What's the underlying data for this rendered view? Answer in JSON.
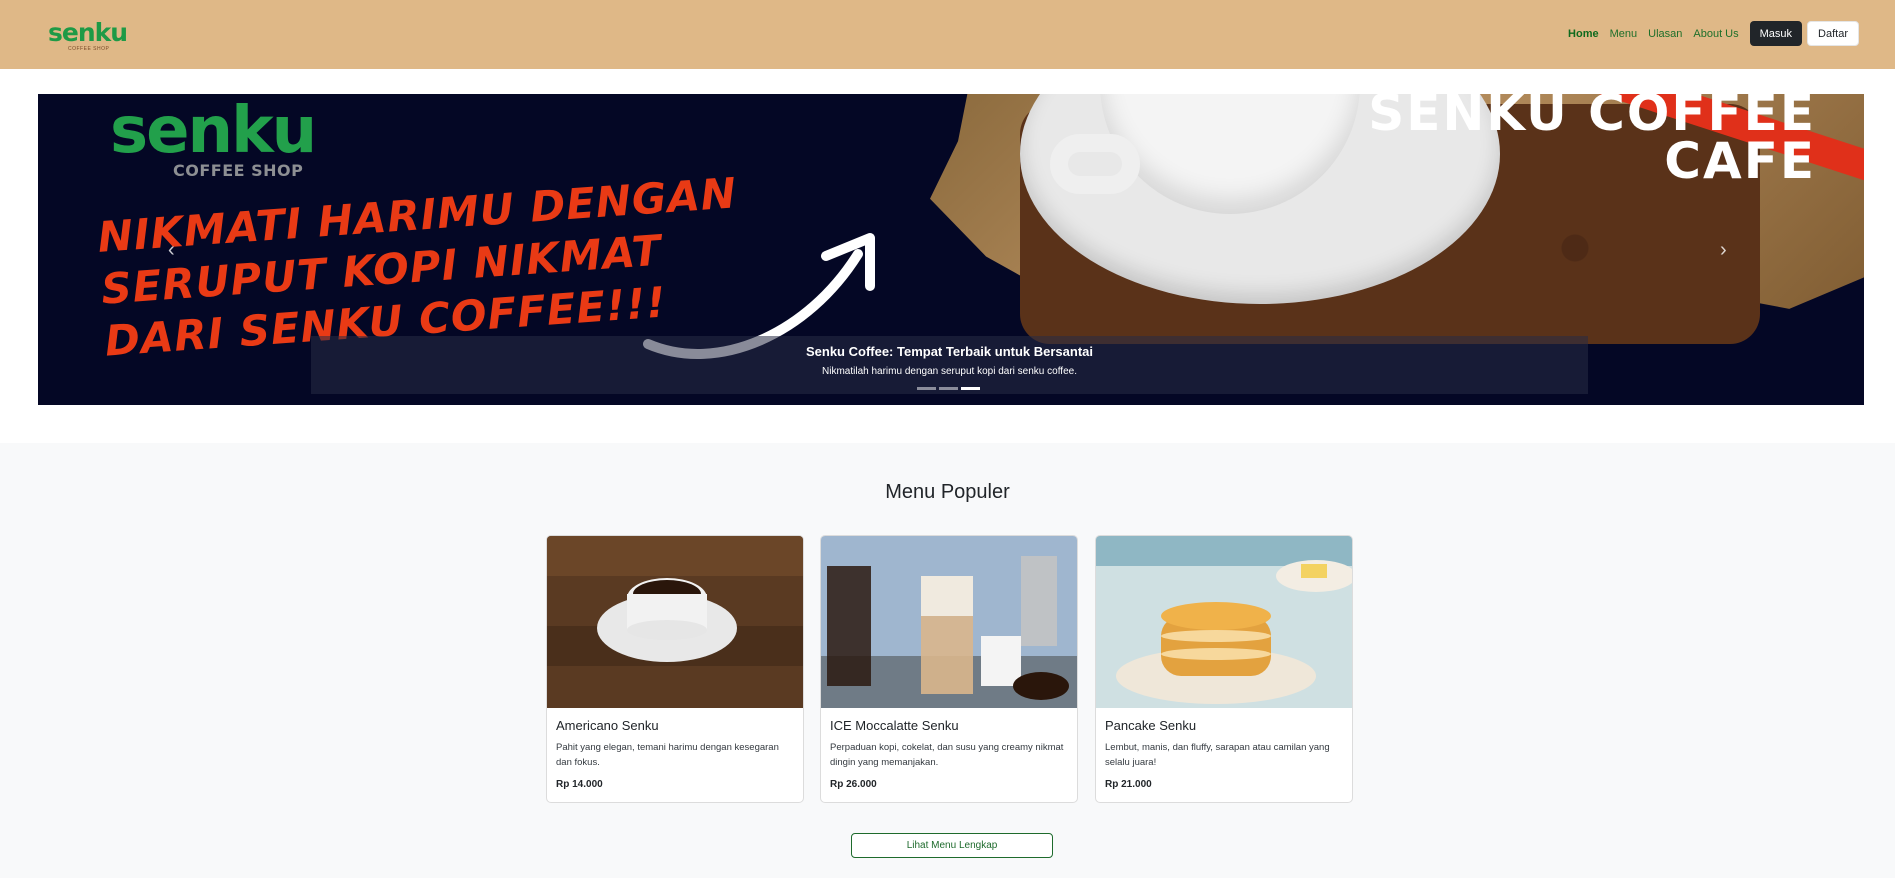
{
  "navbar": {
    "logo_text": "senku",
    "logo_sub": "COFFEE SHOP",
    "links": [
      "Home",
      "Menu",
      "Ulasan",
      "About Us"
    ],
    "login_label": "Masuk",
    "register_label": "Daftar"
  },
  "hero": {
    "logo_text": "senku",
    "logo_sub": "COFFEE SHOP",
    "slogan_lines": [
      "NIKMATI HARIMU DENGAN",
      "SERUPUT KOPI NIKMAT",
      "DARI SENKU COFFEE!!!"
    ],
    "brand_line1": "SENKU COFFEE",
    "brand_line2": "CAFE",
    "caption_title": "Senku Coffee: Tempat Terbaik untuk Bersantai",
    "caption_desc": "Nikmatilah harimu dengan seruput kopi dari senku coffee.",
    "indicator_count": 3,
    "active_indicator": 3,
    "prev_icon": "chevron-left-icon",
    "next_icon": "chevron-right-icon"
  },
  "menu": {
    "title": "Menu Populer",
    "items": [
      {
        "name": "Americano Senku",
        "desc": "Pahit yang elegan, temani harimu dengan kesegaran dan fokus.",
        "price": "Rp 14.000"
      },
      {
        "name": "ICE Moccalatte Senku",
        "desc": "Perpaduan kopi, cokelat, dan susu yang creamy nikmat dingin yang memanjakan.",
        "price": "Rp 26.000"
      },
      {
        "name": "Pancake Senku",
        "desc": "Lembut, manis, dan fluffy, sarapan atau camilan yang selalu juara!",
        "price": "Rp 21.000"
      }
    ],
    "more_label": "Lihat Menu Lengkap"
  },
  "colors": {
    "navbar_bg": "#dfb887",
    "brand_green": "#1e9a46",
    "hero_bg": "#040725",
    "slogan_red": "#e93a15"
  }
}
